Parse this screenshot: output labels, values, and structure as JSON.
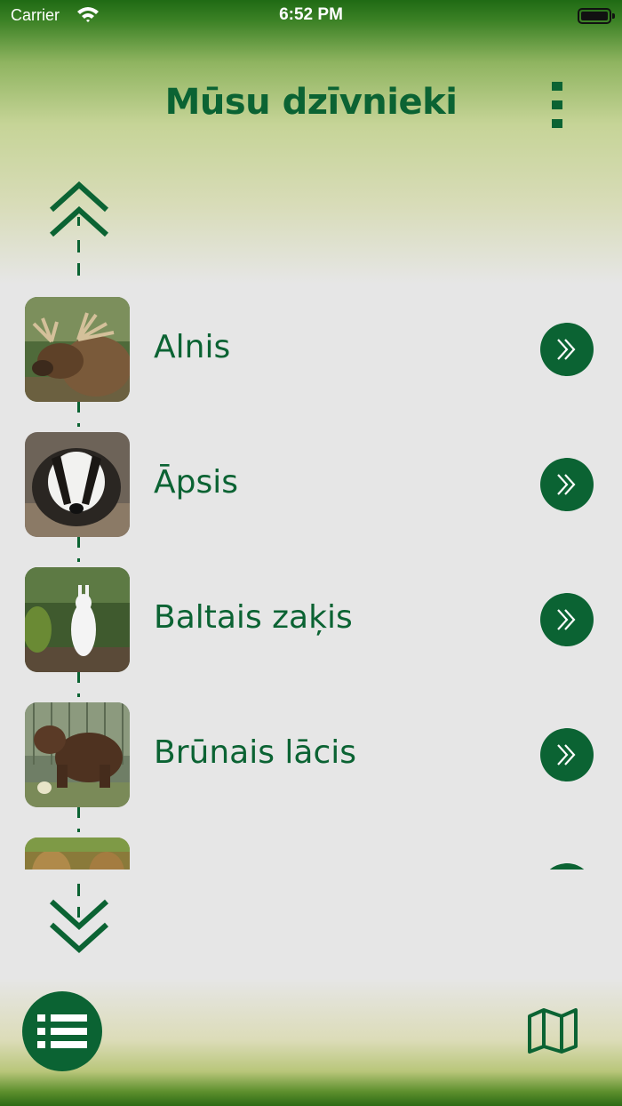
{
  "status_bar": {
    "carrier": "Carrier",
    "time": "6:52 PM"
  },
  "header": {
    "title": "Mūsu dzīvnieki",
    "menu_icon": "more-vertical-icon"
  },
  "colors": {
    "brand_green": "#0b6333",
    "background": "#e6e6e6"
  },
  "animals": [
    {
      "name": "Alnis",
      "image": "moose-photo"
    },
    {
      "name": "Āpsis",
      "image": "badger-photo"
    },
    {
      "name": "Baltais zaķis",
      "image": "white-hare-photo"
    },
    {
      "name": "Brūnais lācis",
      "image": "brown-bear-photo"
    },
    {
      "name": "",
      "image": "partial-animal-photo"
    }
  ],
  "nav": {
    "scroll_up_icon": "double-chevron-up-icon",
    "scroll_down_icon": "double-chevron-down-icon",
    "list_view_icon": "list-icon",
    "map_view_icon": "map-icon"
  }
}
